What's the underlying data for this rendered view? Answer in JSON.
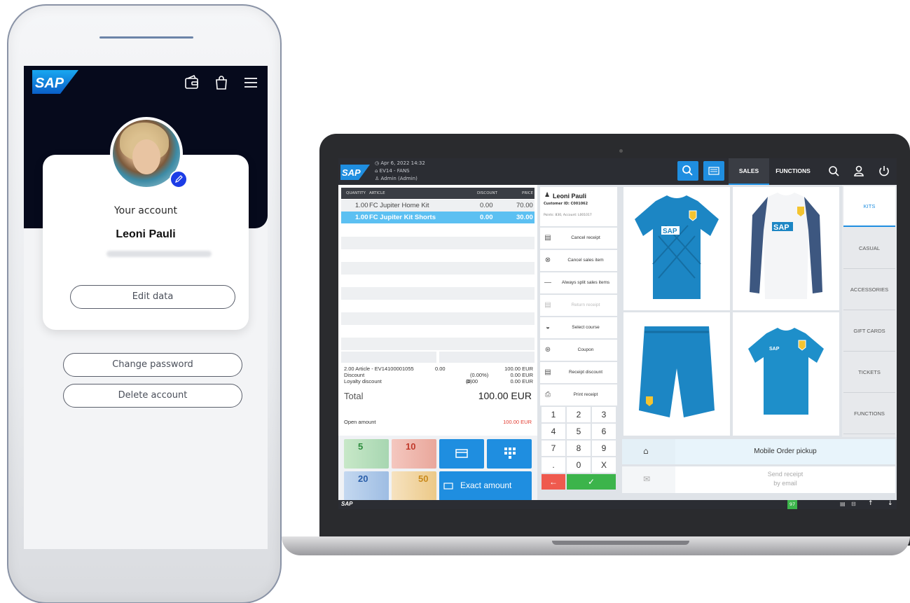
{
  "phone": {
    "logo_text": "SAP",
    "header_icons": [
      "wallet-icon",
      "shopping-bag-icon",
      "menu-icon"
    ],
    "card_title": "Your account",
    "user_name": "Leoni Pauli",
    "edit_button": "Edit data",
    "change_password_button": "Change password",
    "delete_account_button": "Delete account"
  },
  "pos": {
    "logo_text": "SAP",
    "datetime": "Apr 6, 2022 14:32",
    "store": "EV14 - FANS",
    "user": "Admin (Admin)",
    "tabs": [
      "SALES",
      "FUNCTIONS"
    ],
    "receipt": {
      "columns": [
        "QUANTITY",
        "ARTICLE",
        "DISCOUNT",
        "PRICE"
      ],
      "rows": [
        {
          "qty": "1.00",
          "article": "FC Jupiter Home Kit",
          "discount": "0.00",
          "price": "70.00",
          "selected": false
        },
        {
          "qty": "1.00",
          "article": "FC Jupiter Kit Shorts",
          "discount": "0.00",
          "price": "30.00",
          "selected": true
        }
      ],
      "article_summary": "2.00 Article - EV14100001055",
      "article_summary_discount": "0.00",
      "article_summary_total": "100.00 EUR",
      "discount_label": "Discount",
      "discount_pct": "(0.00%)",
      "discount_value": "0.00 EUR",
      "loyalty_label": "Loyalty discount",
      "loyalty_points": "(0.00",
      "loyalty_value": "0.00 EUR",
      "total_label": "Total",
      "total_value": "100.00 EUR",
      "open_amount_label": "Open amount",
      "open_amount_value": "100.00 EUR",
      "banknotes": [
        "5",
        "10",
        "20",
        "50"
      ],
      "exact_amount": "Exact amount"
    },
    "customer": {
      "name": "Leoni Pauli",
      "id_line": "Customer ID: C001062",
      "points_line": "Points: 830, Account: L001017"
    },
    "functions": [
      {
        "label": "Cancel receipt",
        "icon": "receipt-icon",
        "enabled": true
      },
      {
        "label": "Cancel sales item",
        "icon": "cancel-item-icon",
        "enabled": true
      },
      {
        "label": "Always split sales items",
        "icon": "minus-icon",
        "enabled": true
      },
      {
        "label": "Return receipt",
        "icon": "return-icon",
        "enabled": false
      },
      {
        "label": "Select course",
        "icon": "course-icon",
        "enabled": true
      },
      {
        "label": "Coupon",
        "icon": "coupon-icon",
        "enabled": true
      },
      {
        "label": "Receipt discount",
        "icon": "discount-icon",
        "enabled": true
      },
      {
        "label": "Print receipt",
        "icon": "printer-icon",
        "enabled": true
      }
    ],
    "keypad": [
      "1",
      "2",
      "3",
      "4",
      "5",
      "6",
      "7",
      "8",
      "9",
      ".",
      "0",
      "X"
    ],
    "categories": [
      "KITS",
      "CASUAL",
      "ACCESSORIES",
      "GIFT CARDS",
      "TICKETS",
      "FUNCTIONS"
    ],
    "active_category": "KITS",
    "mobile_order": "Mobile Order pickup",
    "send_receipt_line1": "Send receipt",
    "send_receipt_line2": "by email",
    "status_badge": "97",
    "accent_color": "#1f8ee0"
  }
}
